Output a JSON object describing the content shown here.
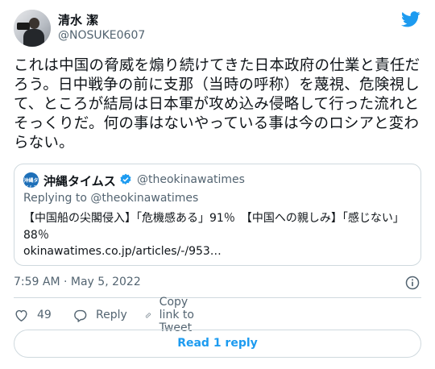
{
  "author": {
    "display_name": "清水 潔",
    "handle": "@NOSUKE0607"
  },
  "tweet": {
    "text": "これは中国の脅威を煽り続けてきた日本政府の仕業と責任だろう。日中戦争の前に支那（当時の呼称）を蔑視、危険視して、ところが結局は日本軍が攻め込み侵略して行った流れとそっくりだ。何の事はないやっている事は今のロシアと変わらない。",
    "timestamp": "7:59 AM · May 5, 2022"
  },
  "quote": {
    "logo_text": "沖縄タイムス",
    "display_name": "沖縄タイムス",
    "handle": "@theokinawatimes",
    "replying_to": "Replying to @theokinawatimes",
    "text": "【中国船の尖閣侵入】「危機感ある」91％　【中国への親しみ】「感じない」88％",
    "link": "okinawatimes.co.jp/articles/-/953…"
  },
  "actions": {
    "like_count": "49",
    "reply_label": "Reply",
    "copy_label": "Copy link to Tweet"
  },
  "read_replies_label": "Read 1 reply",
  "colors": {
    "accent": "#1d9bf0",
    "text": "#0f1419",
    "secondary": "#536471",
    "border": "#cfd9de"
  }
}
